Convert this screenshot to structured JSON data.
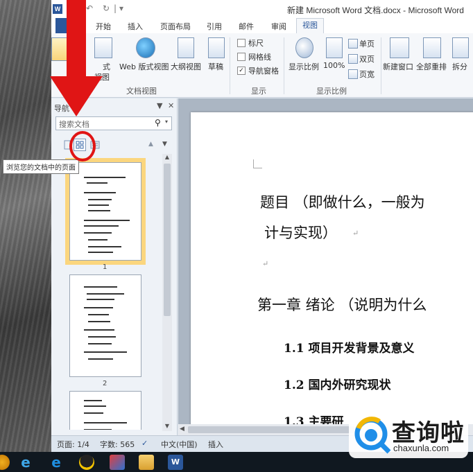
{
  "window": {
    "title": "新建 Microsoft Word 文档.docx - Microsoft Word"
  },
  "tabs": [
    "开始",
    "插入",
    "页面布局",
    "引用",
    "邮件",
    "审阅",
    "视图"
  ],
  "active_tab": "视图",
  "ribbon": {
    "views": {
      "read_label": "式",
      "read_label2": "视图",
      "web_label": "Web 版式视图",
      "outline_label": "大纲视图",
      "draft_label": "草稿",
      "group_label": "文档视图"
    },
    "show": {
      "ruler_label": "标尺",
      "gridlines_label": "网格线",
      "nav_pane_label": "导航窗格",
      "group_label": "显示"
    },
    "zoom": {
      "zoom_label": "显示比例",
      "hundred_label": "100%",
      "one_page_label": "单页",
      "two_pages_label": "双页",
      "page_width_label": "页宽",
      "group_label": "显示比例"
    },
    "window": {
      "new_window_label": "新建窗口",
      "arrange_all_label": "全部重排",
      "split_label": "拆分"
    }
  },
  "nav_pane": {
    "title": "导航",
    "search_placeholder": "搜索文档",
    "tooltip": "浏览您的文档中的页面",
    "pages": [
      {
        "number": "1"
      },
      {
        "number": "2"
      }
    ]
  },
  "document": {
    "lines": [
      "题目 （即做什么，一般为",
      "计与实现）",
      "第一章  绪论  （说明为什么",
      "1.1 项目开发背景及意义",
      "1.2  国内外研究现状",
      "1.3  主要研"
    ]
  },
  "status_bar": {
    "page": "页面: 1/4",
    "words": "字数: 565",
    "language": "中文(中国)",
    "mode": "插入"
  },
  "watermark": {
    "brand": "查询啦",
    "domain": "chaxunla.com"
  },
  "colors": {
    "word_blue": "#2b579a",
    "annotation_red": "#e01515",
    "selected_page": "#fbd67e"
  }
}
